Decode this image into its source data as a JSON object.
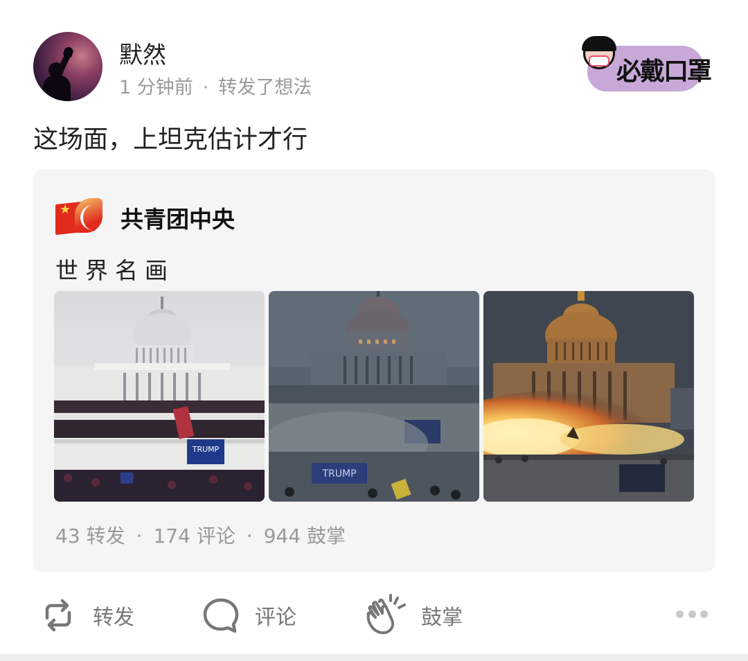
{
  "post": {
    "author": "默然",
    "time": "1 分钟前",
    "separator": "·",
    "action": "转发了想法",
    "text": "这场面，上坦克估计才行"
  },
  "badge": {
    "text": "必戴口罩"
  },
  "quoted": {
    "source_name": "共青团中央",
    "text": "世界名画",
    "stats": {
      "reposts": "43 转发",
      "comments": "174 评论",
      "claps": "944 鼓掌",
      "separator": "·"
    }
  },
  "actions": {
    "repost": "转发",
    "comment": "评论",
    "clap": "鼓掌"
  },
  "icons": [
    "repost-icon",
    "comment-icon",
    "clap-icon",
    "more-icon"
  ],
  "colors": {
    "muted": "#999999",
    "card_bg": "#f5f5f5",
    "text": "#222222"
  }
}
